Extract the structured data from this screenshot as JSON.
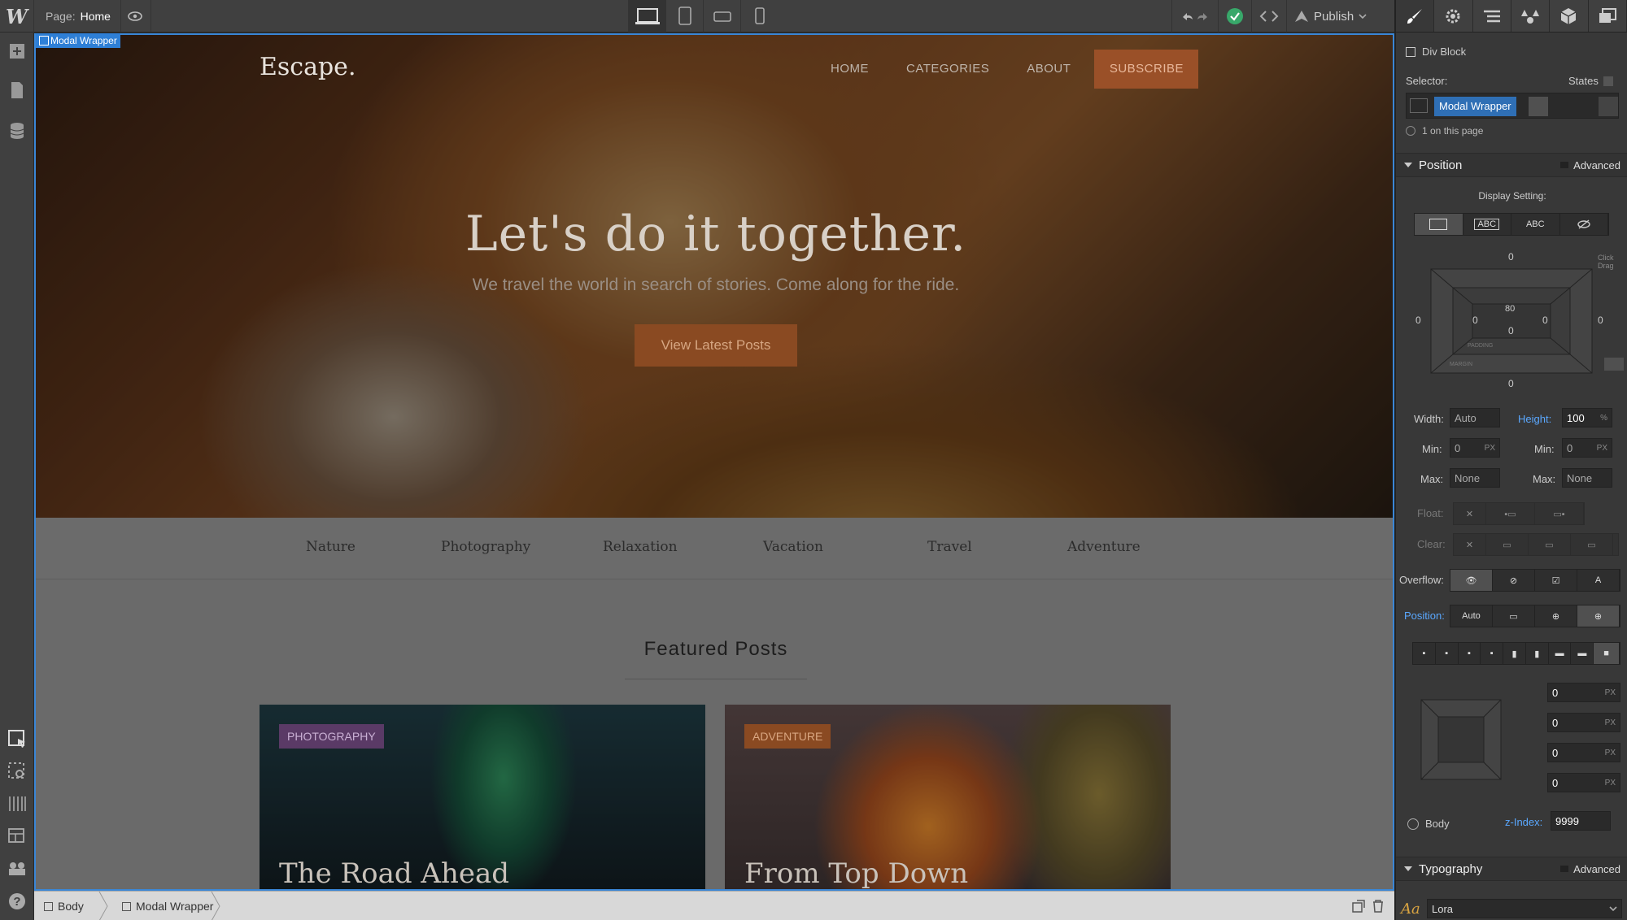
{
  "app": {
    "logo": "W"
  },
  "topbar": {
    "page_label": "Page:",
    "page_name": "Home",
    "publish_label": "Publish"
  },
  "canvas": {
    "selected_tag": "Modal Wrapper",
    "brand": "Escape.",
    "nav": [
      "HOME",
      "CATEGORIES",
      "ABOUT",
      "SUBSCRIBE"
    ],
    "hero_title": "Let's do it together.",
    "hero_subtitle": "We travel the world in search of stories. Come along for the ride.",
    "cta_label": "View Latest Posts",
    "categories": [
      "Nature",
      "Photography",
      "Relaxation",
      "Vacation",
      "Travel",
      "Adventure"
    ],
    "featured_heading": "Featured Posts",
    "cards": [
      {
        "badge": "PHOTOGRAPHY",
        "title": "The Road Ahead"
      },
      {
        "badge": "ADVENTURE",
        "title": "From Top Down"
      }
    ]
  },
  "bottombar": {
    "crumbs": [
      "Body",
      "Modal Wrapper"
    ]
  },
  "panel": {
    "element_type": "Div Block",
    "selector_label": "Selector:",
    "states_label": "States",
    "selector_value": "Modal Wrapper",
    "on_page": "1 on this page",
    "position_section": "Position",
    "advanced_label": "Advanced",
    "display_setting_label": "Display Setting:",
    "display_options": [
      "",
      "ABC",
      "ABC",
      ""
    ],
    "box": {
      "margin_top": "0",
      "margin_left": "0",
      "margin_right": "0",
      "margin_bottom": "0",
      "padding_top": "80",
      "padding_left": "0",
      "padding_right": "0",
      "padding_bottom": "0",
      "padding_label": "PADDING",
      "margin_label": "MARGIN",
      "click_drag": "Click\nDrag"
    },
    "width_label": "Width:",
    "width_value": "Auto",
    "height_label": "Height:",
    "height_value": "100",
    "height_unit": "%",
    "min_label": "Min:",
    "min_w": "0",
    "min_h": "0",
    "px": "PX",
    "max_label": "Max:",
    "max_w": "None",
    "max_h": "None",
    "float_label": "Float:",
    "clear_label": "Clear:",
    "overflow_label": "Overflow:",
    "position_label": "Position:",
    "position_value": "Auto",
    "offsets": [
      "0",
      "0",
      "0",
      "0"
    ],
    "relative_to": "Body",
    "zindex_label": "z-Index:",
    "zindex_value": "9999",
    "typography_section": "Typography",
    "font_value": "Lora",
    "font_icon": "Aa"
  }
}
